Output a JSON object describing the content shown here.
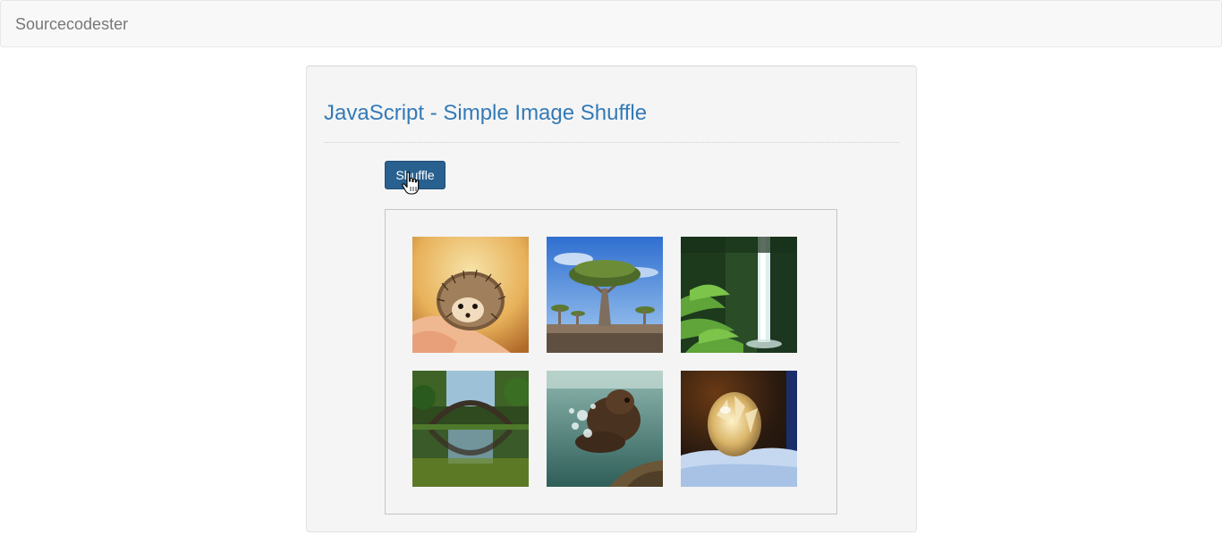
{
  "navbar": {
    "brand": "Sourcecodester"
  },
  "panel": {
    "title": "JavaScript - Simple Image Shuffle",
    "shuffle_label": "Shuffle"
  },
  "gallery": {
    "images": [
      {
        "subject": "hedgehog"
      },
      {
        "subject": "dragon-blood-tree"
      },
      {
        "subject": "waterfall"
      },
      {
        "subject": "arch-bridge-reflection"
      },
      {
        "subject": "underwater-bear"
      },
      {
        "subject": "frozen-bubble"
      }
    ]
  },
  "colors": {
    "brand_text": "#777777",
    "title": "#337ab7",
    "button_bg": "#286090"
  }
}
